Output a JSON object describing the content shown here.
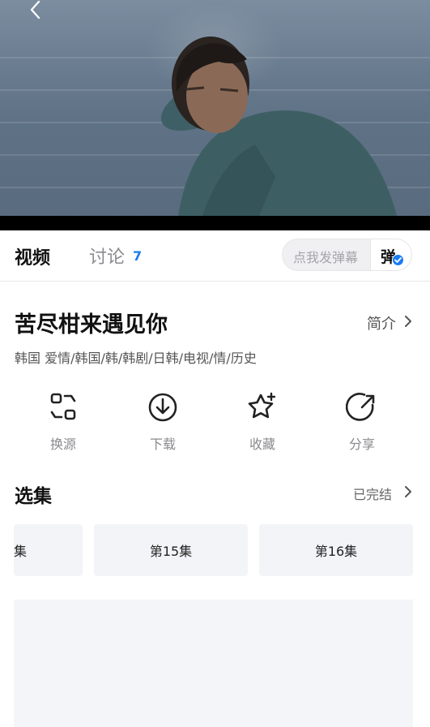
{
  "tabs": {
    "video": "视频",
    "discuss": "讨论",
    "discuss_count": "7"
  },
  "danmu": {
    "placeholder": "点我发弹幕",
    "toggle_label": "弹"
  },
  "show": {
    "title": "苦尽柑来遇见你",
    "intro_label": "简介",
    "tags": "韩国  爱情/韩国/韩/韩剧/日韩/电视/情/历史"
  },
  "actions": [
    {
      "label": "换源",
      "icon": "switch-source-icon"
    },
    {
      "label": "下载",
      "icon": "download-icon"
    },
    {
      "label": "收藏",
      "icon": "star-icon"
    },
    {
      "label": "分享",
      "icon": "share-icon"
    }
  ],
  "episodes": {
    "heading": "选集",
    "status": "已完结",
    "items": [
      "集",
      "第15集",
      "第16集"
    ]
  },
  "colors": {
    "accent": "#1a7cf2",
    "card_bg": "#f2f4f7"
  }
}
